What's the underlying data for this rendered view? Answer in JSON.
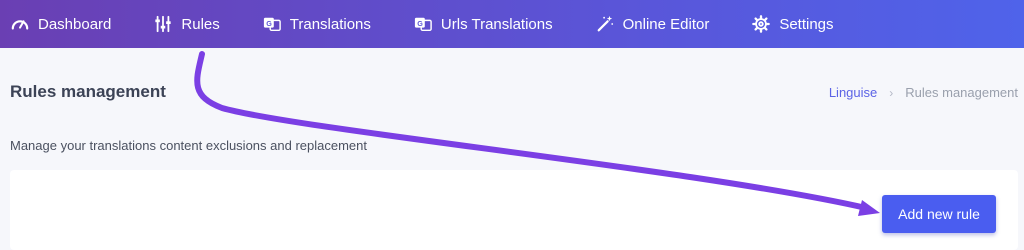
{
  "nav": {
    "items": [
      {
        "label": "Dashboard",
        "icon": "gauge-icon"
      },
      {
        "label": "Rules",
        "icon": "sliders-icon"
      },
      {
        "label": "Translations",
        "icon": "translate-icon"
      },
      {
        "label": "Urls Translations",
        "icon": "translate-icon"
      },
      {
        "label": "Online Editor",
        "icon": "magic-wand-icon"
      },
      {
        "label": "Settings",
        "icon": "gear-icon"
      }
    ]
  },
  "header": {
    "title": "Rules management",
    "breadcrumb": {
      "root": "Linguise",
      "separator": "›",
      "current": "Rules management"
    }
  },
  "main": {
    "subtitle": "Manage your translations content exclusions and replacement",
    "add_button_label": "Add new rule"
  },
  "colors": {
    "nav_gradient_start": "#6a3fb3",
    "nav_gradient_end": "#4f63ea",
    "accent": "#4a5df0",
    "annotation_arrow": "#7b3fe4"
  }
}
